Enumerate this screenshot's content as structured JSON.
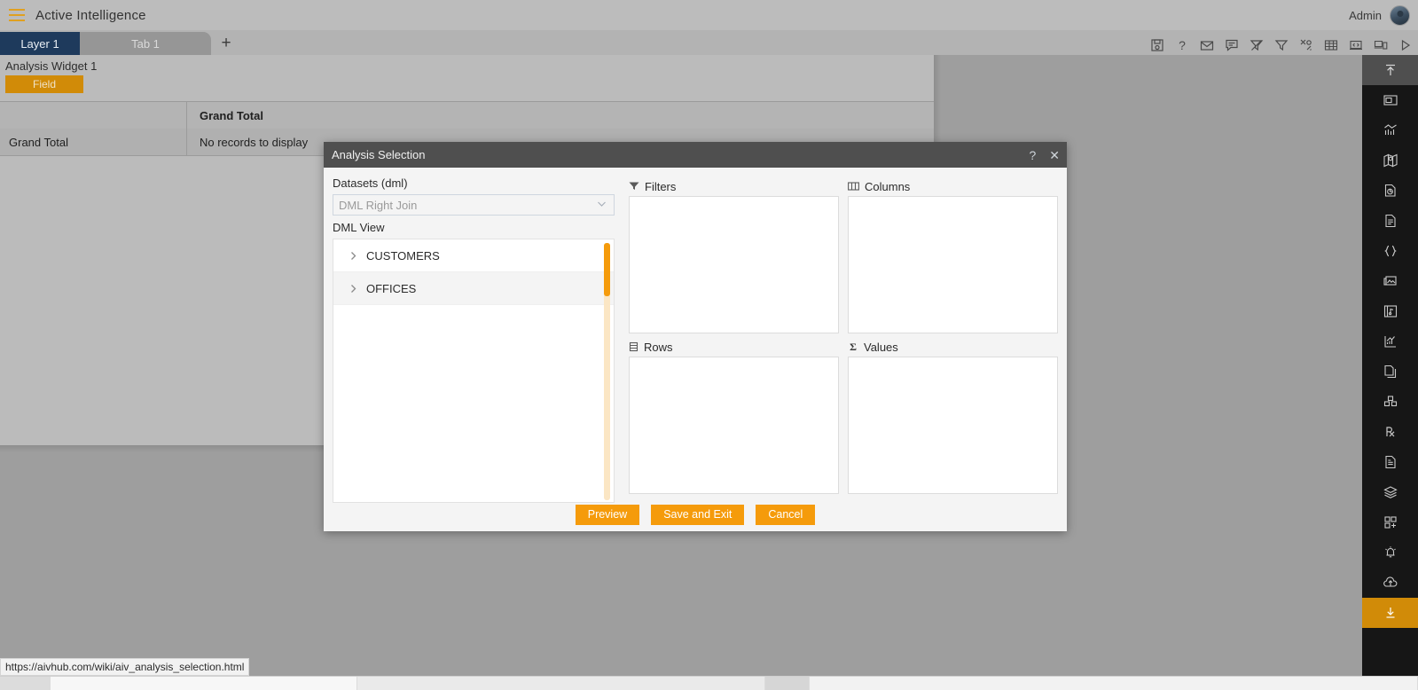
{
  "header": {
    "menu_icon": "hamburger-icon",
    "app_title": "Active Intelligence",
    "user_label": "Admin",
    "avatar_icon": "user-avatar"
  },
  "tabs": {
    "layer_label": "Layer 1",
    "tab_label": "Tab 1",
    "add_label": "+",
    "toolbar_icons": [
      "save-icon",
      "help-icon",
      "mail-icon",
      "comment-icon",
      "clear-filter-icon",
      "filter-icon",
      "tools-icon",
      "table-icon",
      "code-window-icon",
      "devices-icon",
      "run-icon"
    ]
  },
  "widget": {
    "title": "Analysis Widget 1",
    "field_chip": "Field",
    "pivot": {
      "header_row": [
        "",
        "Grand Total"
      ],
      "body_row": [
        "Grand Total",
        "No records to display"
      ]
    }
  },
  "rail": {
    "items": [
      {
        "icon": "collapse-up-icon",
        "state": "active-top"
      },
      {
        "icon": "widget-icon",
        "state": ""
      },
      {
        "icon": "chart-icon",
        "state": ""
      },
      {
        "icon": "map-icon",
        "state": ""
      },
      {
        "icon": "report-icon",
        "state": ""
      },
      {
        "icon": "document-icon",
        "state": ""
      },
      {
        "icon": "braces-icon",
        "state": ""
      },
      {
        "icon": "images-icon",
        "state": ""
      },
      {
        "icon": "media-panel-icon",
        "state": ""
      },
      {
        "icon": "analytics-icon",
        "state": ""
      },
      {
        "icon": "copy-icon",
        "state": ""
      },
      {
        "icon": "blocks-icon",
        "state": ""
      },
      {
        "icon": "prescription-icon",
        "state": ""
      },
      {
        "icon": "form-icon",
        "state": ""
      },
      {
        "icon": "layers-icon",
        "state": ""
      },
      {
        "icon": "add-tile-icon",
        "state": ""
      },
      {
        "icon": "alert-bell-icon",
        "state": ""
      },
      {
        "icon": "cloud-upload-icon",
        "state": ""
      },
      {
        "icon": "download-icon",
        "state": "active-bottom"
      }
    ]
  },
  "modal": {
    "title": "Analysis Selection",
    "help_icon": "help-icon",
    "close_icon": "close-icon",
    "datasets_label": "Datasets (dml)",
    "dataset_value": "DML Right Join",
    "dataset_placeholder": "DML Right Join",
    "chevron_icon": "chevron-down-icon",
    "view_label": "DML View",
    "tree_items": [
      {
        "label": "CUSTOMERS",
        "expand_icon": "chevron-right-icon"
      },
      {
        "label": "OFFICES",
        "expand_icon": "chevron-right-icon"
      }
    ],
    "zones": [
      {
        "label": "Filters",
        "icon": "filter-icon"
      },
      {
        "label": "Columns",
        "icon": "columns-icon"
      },
      {
        "label": "Rows",
        "icon": "rows-icon"
      },
      {
        "label": "Values",
        "icon": "sigma-icon"
      }
    ],
    "buttons": {
      "preview": "Preview",
      "save_and_exit": "Save and Exit",
      "cancel": "Cancel"
    }
  },
  "status": {
    "url": "https://aivhub.com/wiki/aiv_analysis_selection.html"
  },
  "colors": {
    "accent_orange": "#f59b0b",
    "chip_orange": "#d18b08",
    "layer_blue": "#1e3a5c",
    "rail_dark": "#161616",
    "modal_titlebar": "#4f4f4f"
  }
}
